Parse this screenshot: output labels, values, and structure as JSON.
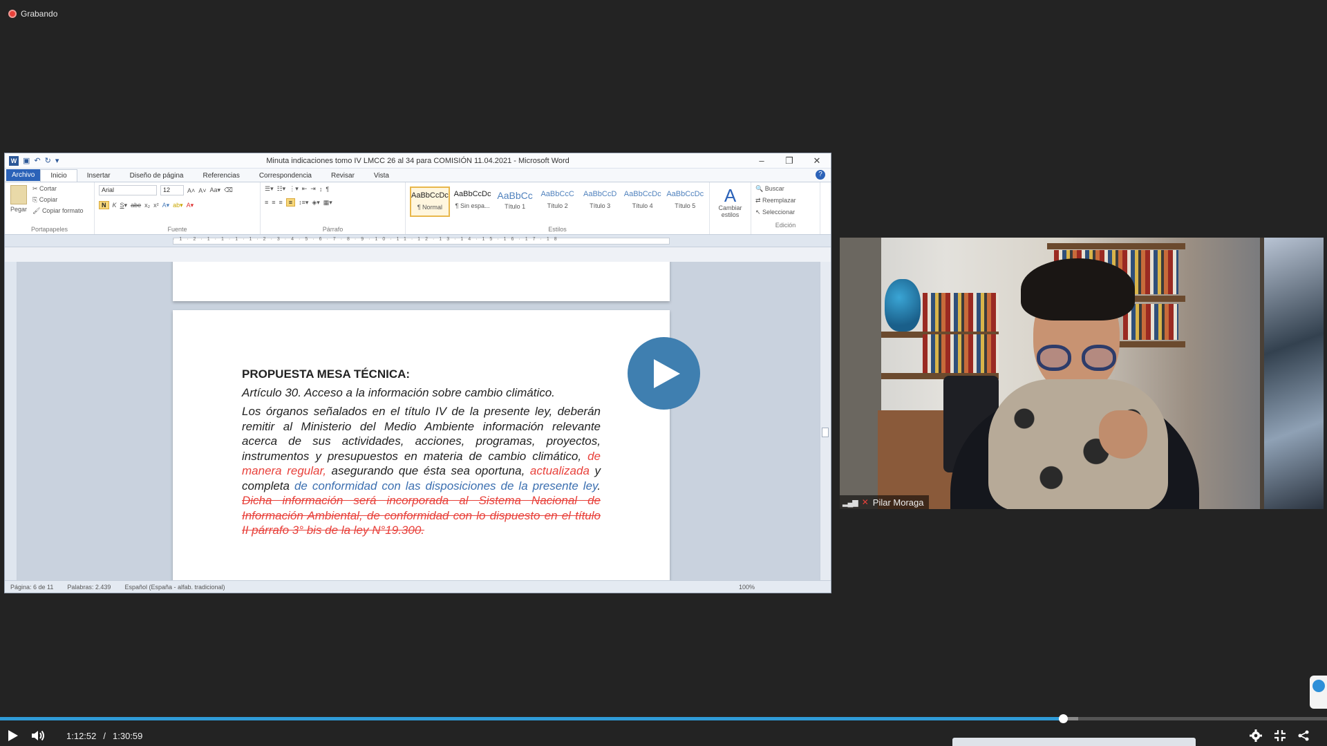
{
  "recording": {
    "label": "Grabando",
    "color": "#e8403a"
  },
  "word": {
    "window_title": "Minuta indicaciones tomo IV LMCC 26 al 34 para COMISIÓN 11.04.2021 - Microsoft Word",
    "tabs": [
      "Archivo",
      "Inicio",
      "Insertar",
      "Diseño de página",
      "Referencias",
      "Correspondencia",
      "Revisar",
      "Vista"
    ],
    "clipboard": {
      "paste": "Pegar",
      "cut": "Cortar",
      "copy": "Copiar",
      "format_painter": "Copiar formato",
      "label": "Portapapeles"
    },
    "font": {
      "name": "Arial",
      "size": "12",
      "label": "Fuente"
    },
    "paragraph": {
      "label": "Párrafo"
    },
    "styles": {
      "label": "Estilos",
      "items": [
        {
          "sample": "AaBbCcDc",
          "name": "¶ Normal"
        },
        {
          "sample": "AaBbCcDc",
          "name": "¶ Sin espa..."
        },
        {
          "sample": "AaBbCc",
          "name": "Título 1"
        },
        {
          "sample": "AaBbCcC",
          "name": "Título 2"
        },
        {
          "sample": "AaBbCcD",
          "name": "Título 3"
        },
        {
          "sample": "AaBbCcDc",
          "name": "Título 4"
        },
        {
          "sample": "AaBbCcDc",
          "name": "Título 5"
        }
      ],
      "change": "Cambiar estilos"
    },
    "editing": {
      "find": "Buscar",
      "replace": "Reemplazar",
      "select": "Seleccionar",
      "label": "Edición"
    },
    "document": {
      "heading": "PROPUESTA MESA TÉCNICA:",
      "article": "Artículo 30.   Acceso a la información sobre cambio climático.",
      "p_normal1": "Los órganos señalados en el título IV de la presente ley, deberán remitir al Ministerio del Medio Ambiente información relevante acerca de sus actividades, acciones, programas, proyectos, instrumentos y presupuestos en materia de cambio climático, ",
      "p_red1": "de manera regular,",
      "p_normal2": " asegurando que ésta sea oportuna, ",
      "p_red2": "actualizada",
      "p_normal3": " y completa ",
      "p_blue": "de conformidad con las disposiciones de la presente ley",
      "p_normal4": ". ",
      "p_strike": "Dicha información será incorporada al Sistema Nacional de Información Ambiental, de conformidad con lo dispuesto en el título II párrafo 3° bis de la ley N°19.300."
    },
    "status": {
      "page": "Página: 6 de 11",
      "words": "Palabras: 2.439",
      "language": "Español (España - alfab. tradicional)",
      "zoom": "100%"
    }
  },
  "participant": {
    "name": "Pilar Moraga"
  },
  "player": {
    "current_time": "1:12:52",
    "separator": "/",
    "duration": "1:30:59",
    "progress_fraction": 0.8011,
    "buffered_fraction": 0.8125,
    "accent": "#2f9bd8"
  }
}
